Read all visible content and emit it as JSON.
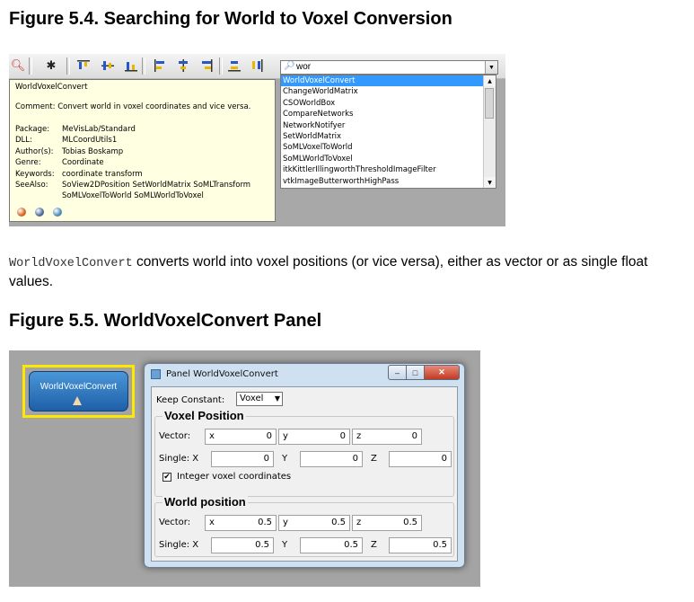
{
  "figure1": {
    "title": "Figure 5.4. Searching for World to Voxel Conversion",
    "toolbar": {
      "icons": [
        "zoom-icon",
        "bug-icon",
        "align-top-icon",
        "align-center-vertical-icon",
        "align-bottom-icon",
        "align-left-icon",
        "align-center-horizontal-icon",
        "align-right-icon",
        "distribute-horizontal-icon",
        "distribute-vertical-icon"
      ]
    },
    "search": {
      "value": "wor",
      "placeholder": ""
    },
    "results": [
      "WorldVoxelConvert",
      "ChangeWorldMatrix",
      "CSOWorldBox",
      "CompareNetworks",
      "NetworkNotifyer",
      "SetWorldMatrix",
      "SoMLVoxelToWorld",
      "SoMLWorldToVoxel",
      "itkKittlerIllingworthThresholdImageFilter",
      "vtkImageButterworthHighPass"
    ],
    "selected_index": 0,
    "tooltip": {
      "name": "WorldVoxelConvert",
      "comment": "Comment:  Convert world in voxel coordinates and vice versa.",
      "rows": [
        {
          "key": "Package:",
          "value": "MeVisLab/Standard"
        },
        {
          "key": "DLL:",
          "value": "MLCoordUtils1"
        },
        {
          "key": "Author(s):",
          "value": "Tobias Boskamp"
        },
        {
          "key": "Genre:",
          "value": "Coordinate"
        },
        {
          "key": "Keywords:",
          "value": "coordinate transform"
        },
        {
          "key": "SeeAlso:",
          "value": "SoView2DPosition SetWorldMatrix SoMLTransform"
        },
        {
          "key": "",
          "value": "SoMLVoxelToWorld SoMLWorldToVoxel"
        }
      ],
      "icon_colors": [
        "#d86020",
        "#4a6a9a",
        "#4a8ab8"
      ]
    }
  },
  "paragraph": {
    "code": "WorldVoxelConvert",
    "text": " converts world into voxel positions (or vice versa), either as vector or as single float values."
  },
  "figure2": {
    "title": "Figure 5.5. WorldVoxelConvert Panel",
    "module_label": "WorldVoxelConvert",
    "panel": {
      "title": "Panel WorldVoxelConvert",
      "keep_constant_label": "Keep Constant:",
      "keep_constant_value": "Voxel",
      "voxel": {
        "title": "Voxel Position",
        "vector_label": "Vector:",
        "vector": [
          {
            "axis": "x",
            "value": "0"
          },
          {
            "axis": "y",
            "value": "0"
          },
          {
            "axis": "z",
            "value": "0"
          }
        ],
        "single_label": "Single: X",
        "y_label": "Y",
        "z_label": "Z",
        "single": [
          "0",
          "0",
          "0"
        ],
        "integer_label": "Integer voxel coordinates",
        "integer_checked": "✔"
      },
      "world": {
        "title": "World position",
        "vector_label": "Vector:",
        "vector": [
          {
            "axis": "x",
            "value": "0.5"
          },
          {
            "axis": "y",
            "value": "0.5"
          },
          {
            "axis": "z",
            "value": "0.5"
          }
        ],
        "single_label": "Single: X",
        "y_label": "Y",
        "z_label": "Z",
        "single": [
          "0.5",
          "0.5",
          "0.5"
        ]
      }
    }
  }
}
